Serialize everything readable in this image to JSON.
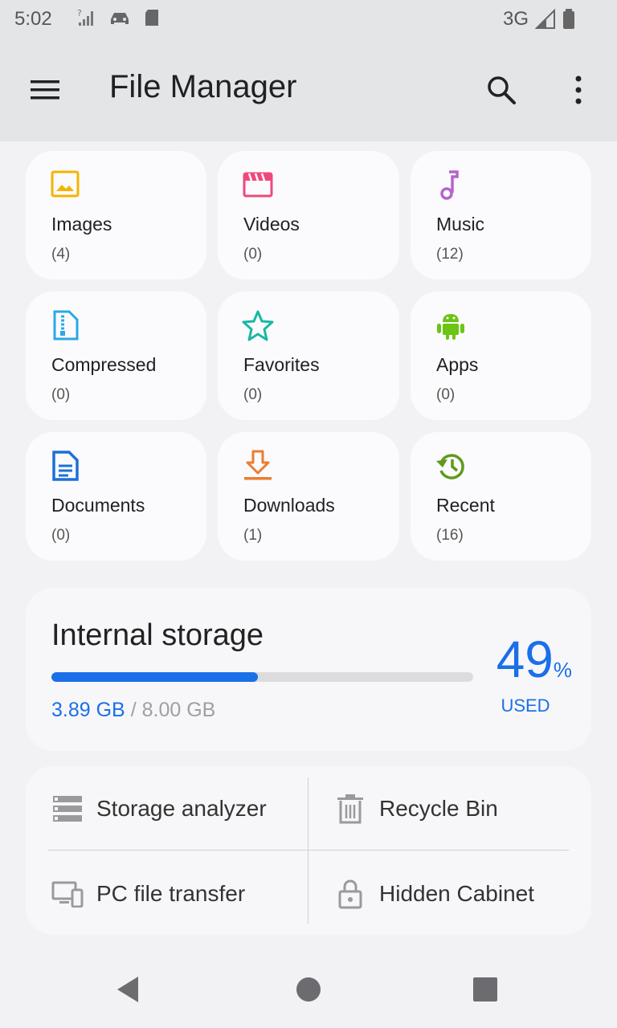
{
  "status_bar": {
    "time": "5:02",
    "network": "3G"
  },
  "app_bar": {
    "title": "File Manager"
  },
  "categories": [
    {
      "label": "Images",
      "count": "(4)",
      "icon": "image-icon",
      "color": "#f4b400"
    },
    {
      "label": "Videos",
      "count": "(0)",
      "icon": "video-icon",
      "color": "#f0487c"
    },
    {
      "label": "Music",
      "count": "(12)",
      "icon": "music-icon",
      "color": "#b565c9"
    },
    {
      "label": "Compressed",
      "count": "(0)",
      "icon": "zip-icon",
      "color": "#29a8e8"
    },
    {
      "label": "Favorites",
      "count": "(0)",
      "icon": "star-icon",
      "color": "#19b8a4"
    },
    {
      "label": "Apps",
      "count": "(0)",
      "icon": "android-icon",
      "color": "#6cc414"
    },
    {
      "label": "Documents",
      "count": "(0)",
      "icon": "document-icon",
      "color": "#1e6fd9"
    },
    {
      "label": "Downloads",
      "count": "(1)",
      "icon": "download-icon",
      "color": "#ee7b30"
    },
    {
      "label": "Recent",
      "count": "(16)",
      "icon": "history-icon",
      "color": "#5f9a1c"
    }
  ],
  "storage": {
    "title": "Internal storage",
    "used": "3.89 GB",
    "separator": "/",
    "total": "8.00 GB",
    "percent": "49",
    "percent_sign": "%",
    "used_label": "USED",
    "used_fraction": 0.49
  },
  "tools": [
    {
      "label": "Storage analyzer",
      "icon": "storage-analyzer-icon"
    },
    {
      "label": "Recycle Bin",
      "icon": "trash-icon"
    },
    {
      "label": "PC file transfer",
      "icon": "pc-transfer-icon"
    },
    {
      "label": "Hidden Cabinet",
      "icon": "lock-icon"
    }
  ],
  "colors": {
    "accent": "#1b6fe8",
    "surface": "#f2f2f4",
    "appbar": "#e4e5e7"
  }
}
